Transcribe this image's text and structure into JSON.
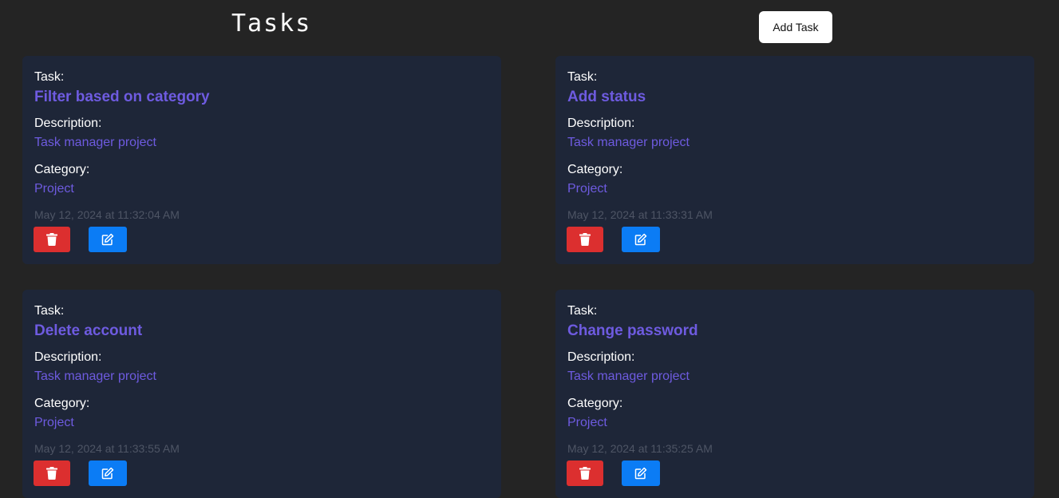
{
  "header": {
    "title": "Tasks",
    "add_task_label": "Add Task"
  },
  "labels": {
    "task": "Task:",
    "description": "Description:",
    "category": "Category:"
  },
  "colors": {
    "background": "#242424",
    "card": "#1e2638",
    "accent_text": "#6e5be0",
    "delete_button": "#dc2f2f",
    "edit_button": "#0b7cf5"
  },
  "icons": {
    "delete": "trash-icon",
    "edit": "edit-icon"
  },
  "tasks": [
    {
      "title": "Filter based on category",
      "description": "Task manager project",
      "category": "Project",
      "timestamp": "May 12, 2024 at 11:32:04 AM"
    },
    {
      "title": "Add status",
      "description": "Task manager project",
      "category": "Project",
      "timestamp": "May 12, 2024 at 11:33:31 AM"
    },
    {
      "title": "Delete account",
      "description": "Task manager project",
      "category": "Project",
      "timestamp": "May 12, 2024 at 11:33:55 AM"
    },
    {
      "title": "Change password",
      "description": "Task manager project",
      "category": "Project",
      "timestamp": "May 12, 2024 at 11:35:25 AM"
    }
  ]
}
